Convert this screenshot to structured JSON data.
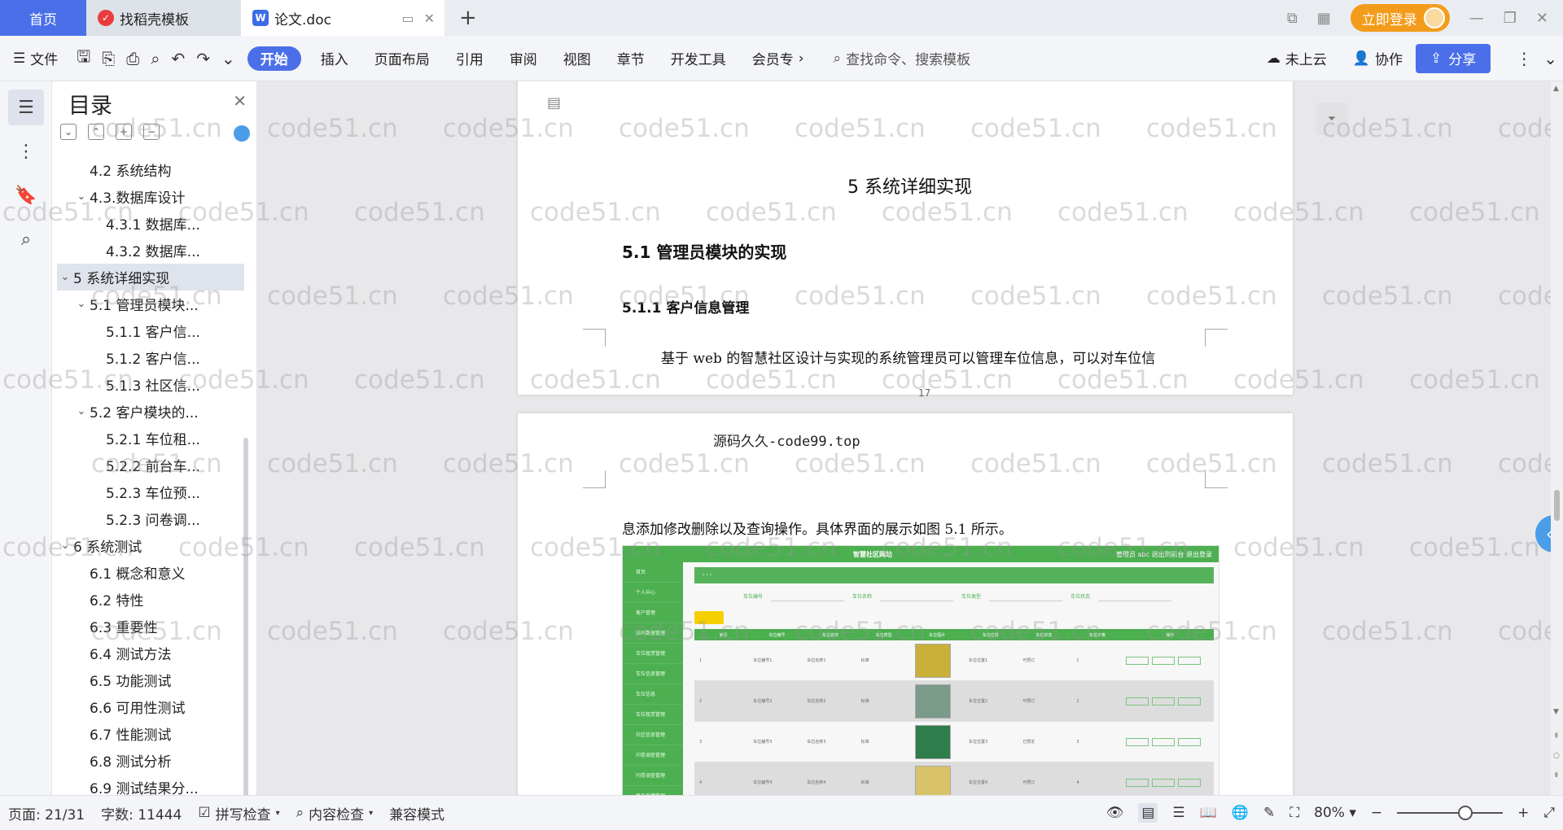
{
  "tabs": {
    "home": "首页",
    "template": "找稻壳模板",
    "doc": "论文.doc"
  },
  "titlebar": {
    "login": "立即登录"
  },
  "ribbon": {
    "file": "文件",
    "start": "开始",
    "insert": "插入",
    "layout": "页面布局",
    "reference": "引用",
    "review": "审阅",
    "view": "视图",
    "chapter": "章节",
    "devtools": "开发工具",
    "member": "会员专",
    "search": "查找命令、搜索模板",
    "cloud": "未上云",
    "collab": "协作",
    "share": "分享"
  },
  "toc": {
    "title": "目录",
    "items": [
      {
        "label": "4.2 系统结构",
        "level": 2,
        "chev": ""
      },
      {
        "label": "4.3.数据库设计",
        "level": 2,
        "chev": "⌄"
      },
      {
        "label": "4.3.1 数据库...",
        "level": 3,
        "chev": ""
      },
      {
        "label": "4.3.2 数据库...",
        "level": 3,
        "chev": ""
      },
      {
        "label": "5 系统详细实现",
        "level": 1,
        "chev": "⌄"
      },
      {
        "label": "5.1 管理员模块...",
        "level": 2,
        "chev": "⌄"
      },
      {
        "label": "5.1.1 客户信...",
        "level": 3,
        "chev": ""
      },
      {
        "label": "5.1.2 客户信...",
        "level": 3,
        "chev": ""
      },
      {
        "label": "5.1.3 社区信...",
        "level": 3,
        "chev": ""
      },
      {
        "label": "5.2 客户模块的...",
        "level": 2,
        "chev": "⌄"
      },
      {
        "label": "5.2.1 车位租...",
        "level": 3,
        "chev": ""
      },
      {
        "label": "5.2.2 前台车...",
        "level": 3,
        "chev": ""
      },
      {
        "label": "5.2.3 车位预...",
        "level": 3,
        "chev": ""
      },
      {
        "label": "5.2.3 问卷调...",
        "level": 3,
        "chev": ""
      },
      {
        "label": "6 系统测试",
        "level": 1,
        "chev": "⌄"
      },
      {
        "label": "6.1 概念和意义",
        "level": 2,
        "chev": ""
      },
      {
        "label": "6.2 特性",
        "level": 2,
        "chev": ""
      },
      {
        "label": "6.3 重要性",
        "level": 2,
        "chev": ""
      },
      {
        "label": "6.4 测试方法",
        "level": 2,
        "chev": ""
      },
      {
        "label": "6.5 功能测试",
        "level": 2,
        "chev": ""
      },
      {
        "label": "6.6 可用性测试",
        "level": 2,
        "chev": ""
      },
      {
        "label": "6.7 性能测试",
        "level": 2,
        "chev": ""
      },
      {
        "label": "6.8 测试分析",
        "level": 2,
        "chev": ""
      },
      {
        "label": "6.9 测试结果分...",
        "level": 2,
        "chev": ""
      }
    ]
  },
  "document": {
    "chapter": "5 系统详细实现",
    "section": "5.1  管理员模块的实现",
    "subsection": "5.1.1  客户信息管理",
    "para1": "基于 web 的智慧社区设计与实现的系统管理员可以管理车位信息，可以对车位信",
    "page_number": "17",
    "source": "源码久久-code99.top",
    "para2": "息添加修改删除以及查询操作。具体界面的展示如图 5.1 所示。"
  },
  "screenshot": {
    "site_title": "智慧社区网站",
    "top_right": "管理员 abc   退出到前台   退出登录",
    "menu": [
      "首页",
      "个人中心",
      "客户管理",
      "访问数据管理",
      "车位租赁管理",
      "车位信息管理",
      "车位信息",
      "车位租赁管理",
      "社区信息管理",
      "问卷调查管理",
      "问卷调查管理",
      "意见反馈管理"
    ],
    "headers": [
      "索引",
      "车位编号",
      "车位名称",
      "车位类型",
      "车位图片",
      "车位位置",
      "车位状态",
      "车位价格",
      "操作"
    ],
    "rows": [
      [
        "1",
        "车位编号1",
        "车位名称1",
        "标准",
        "",
        "车位位置1",
        "可预订",
        "1"
      ],
      [
        "2",
        "车位编号2",
        "车位名称2",
        "标准",
        "",
        "车位位置2",
        "可预订",
        "2"
      ],
      [
        "3",
        "车位编号3",
        "车位名称3",
        "标准",
        "",
        "车位位置3",
        "已预定",
        "3"
      ],
      [
        "4",
        "车位编号4",
        "车位名称4",
        "标准",
        "",
        "车位位置4",
        "可预订",
        "4"
      ]
    ]
  },
  "watermark": "code51.cn",
  "status": {
    "page": "页面: 21/31",
    "words": "字数: 11444",
    "spell": "拼写检查",
    "content": "内容检查",
    "compat": "兼容模式",
    "zoom": "80%"
  }
}
